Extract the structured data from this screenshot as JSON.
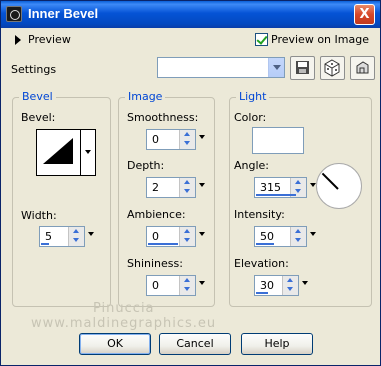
{
  "window": {
    "title": "Inner Bevel",
    "close_glyph": "X"
  },
  "preview": {
    "label": "Preview",
    "preview_on_image_label": "Preview on Image",
    "preview_on_image_checked": true
  },
  "settings": {
    "label": "Settings",
    "value": ""
  },
  "bevel": {
    "group_title": "Bevel",
    "bevel_label": "Bevel:",
    "width_label": "Width:",
    "width_value": "5"
  },
  "image": {
    "group_title": "Image",
    "smoothness_label": "Smoothness:",
    "smoothness_value": "0",
    "depth_label": "Depth:",
    "depth_value": "2",
    "ambience_label": "Ambience:",
    "ambience_value": "0",
    "shininess_label": "Shininess:",
    "shininess_value": "0"
  },
  "light": {
    "group_title": "Light",
    "color_label": "Color:",
    "color_value": "#ffffff",
    "angle_label": "Angle:",
    "angle_value": "315",
    "intensity_label": "Intensity:",
    "intensity_value": "50",
    "elevation_label": "Elevation:",
    "elevation_value": "30"
  },
  "watermark": {
    "line1": "Pinuccia",
    "line2": "www.maldinegraphics.eu"
  },
  "buttons": {
    "ok": "OK",
    "cancel": "Cancel",
    "help": "Help"
  }
}
